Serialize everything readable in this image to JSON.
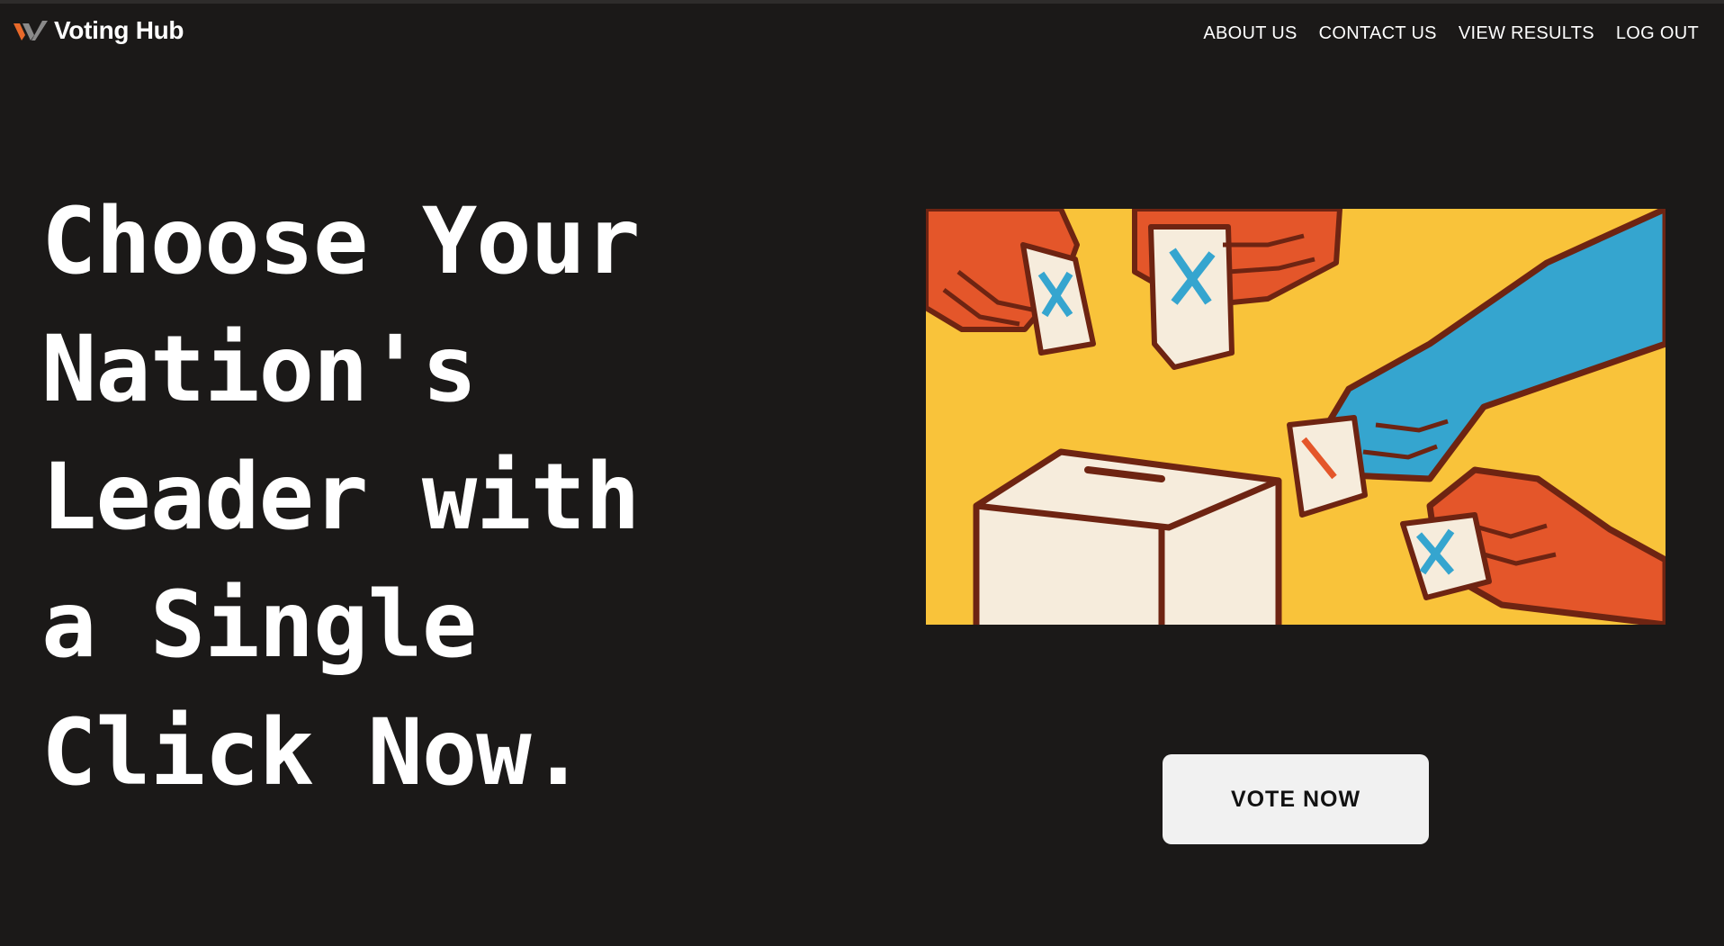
{
  "brand": {
    "name": "Voting Hub",
    "logo_icon": "double-chevron-logo-icon",
    "logo_colors": [
      "#e8692a",
      "#8a8a8a"
    ]
  },
  "nav": {
    "items": [
      {
        "label": "ABOUT US"
      },
      {
        "label": "CONTACT US"
      },
      {
        "label": "VIEW RESULTS"
      },
      {
        "label": "LOG OUT"
      }
    ]
  },
  "hero": {
    "headline_lines": [
      "Choose Your",
      "Nation's",
      "Leader with",
      "a Single",
      "Click Now."
    ],
    "image": {
      "subject": "hands-casting-ballots-illustration",
      "colors": {
        "background": "#f9c33a",
        "outline": "#6e2412",
        "orange_hand": "#e4562a",
        "blue_hand": "#35a5cf",
        "paper": "#f6ecdc",
        "mark": "#2a9fd6"
      }
    },
    "cta_label": "VOTE NOW"
  },
  "theme": {
    "background": "#1b1918",
    "text": "#ffffff",
    "button_bg": "#f1f1f1",
    "button_text": "#111111"
  }
}
